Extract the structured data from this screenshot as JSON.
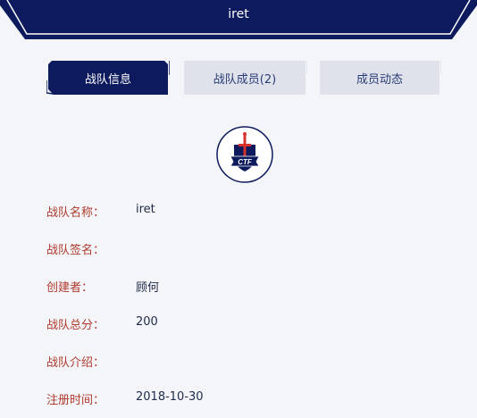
{
  "header": {
    "title": "iret"
  },
  "tabs": [
    {
      "label": "战队信息",
      "active": true
    },
    {
      "label": "战队成员(2)",
      "active": false
    },
    {
      "label": "成员动态",
      "active": false
    }
  ],
  "logo": {
    "text": "CTF",
    "icon": "sword-shield-icon"
  },
  "info": {
    "name": {
      "label": "战队名称：",
      "value": "iret"
    },
    "sign": {
      "label": "战队签名：",
      "value": ""
    },
    "creator": {
      "label": "创建者：",
      "value": "顾何"
    },
    "score": {
      "label": "战队总分：",
      "value": "200"
    },
    "intro": {
      "label": "战队介绍：",
      "value": ""
    },
    "date": {
      "label": "注册时间：",
      "value": "2018-10-30"
    }
  },
  "colors": {
    "navy": "#0d1b5e",
    "label_red": "#b03a2e",
    "tab_inactive_bg": "#dfe2ea",
    "background": "#f4f5f8"
  }
}
